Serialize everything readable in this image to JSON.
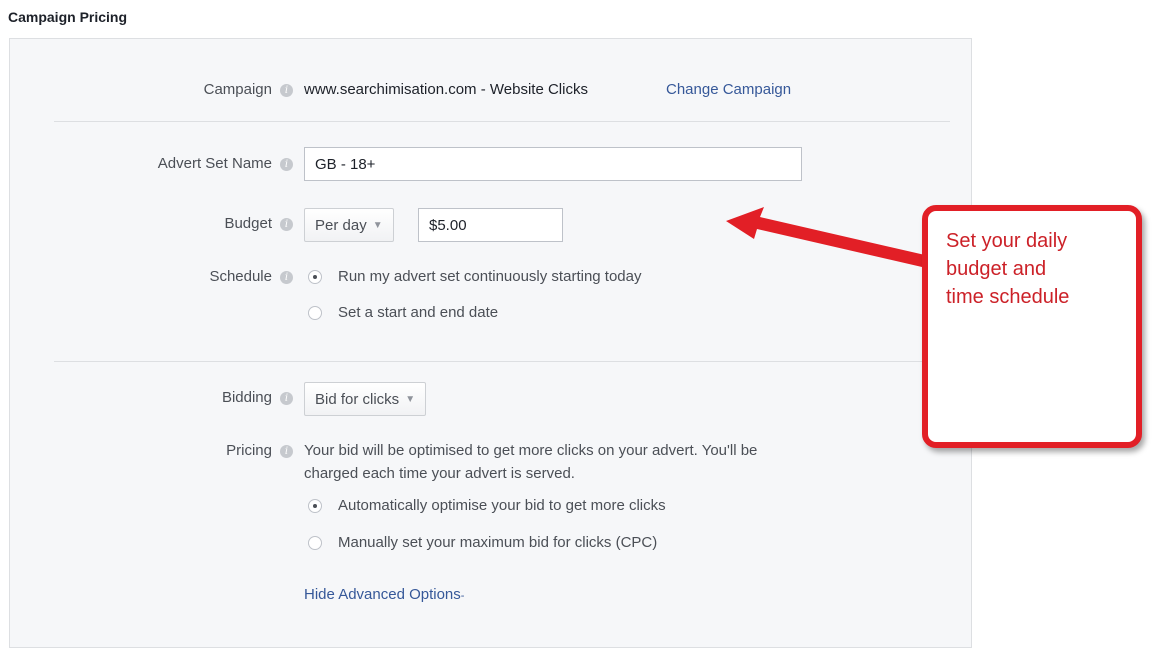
{
  "section_title": "Campaign Pricing",
  "campaign": {
    "label": "Campaign",
    "value": "www.searchimisation.com - Website Clicks",
    "change_link": "Change Campaign"
  },
  "advert_set_name": {
    "label": "Advert Set Name",
    "value": "GB - 18+"
  },
  "budget": {
    "label": "Budget",
    "period": "Per day",
    "amount": "$5.00"
  },
  "schedule": {
    "label": "Schedule",
    "options": [
      {
        "label": "Run my advert set continuously starting today",
        "checked": true
      },
      {
        "label": "Set a start and end date",
        "checked": false
      }
    ]
  },
  "bidding": {
    "label": "Bidding",
    "value": "Bid for clicks"
  },
  "pricing": {
    "label": "Pricing",
    "description_line1": "Your bid will be optimised to get more clicks on your advert. You'll be",
    "description_line2": "charged each time your advert is served.",
    "options": [
      {
        "label": "Automatically optimise your bid to get more clicks",
        "checked": true
      },
      {
        "label": "Manually set your maximum bid for clicks (CPC)",
        "checked": false
      }
    ]
  },
  "hide_advanced": "Hide Advanced Options",
  "info_glyph": "i",
  "caret_glyph": "▼",
  "callout": {
    "line1": "Set your daily",
    "line2": "budget and",
    "line3": "time schedule"
  },
  "colors": {
    "accent_red": "#e21f26",
    "link_blue": "#365899"
  }
}
